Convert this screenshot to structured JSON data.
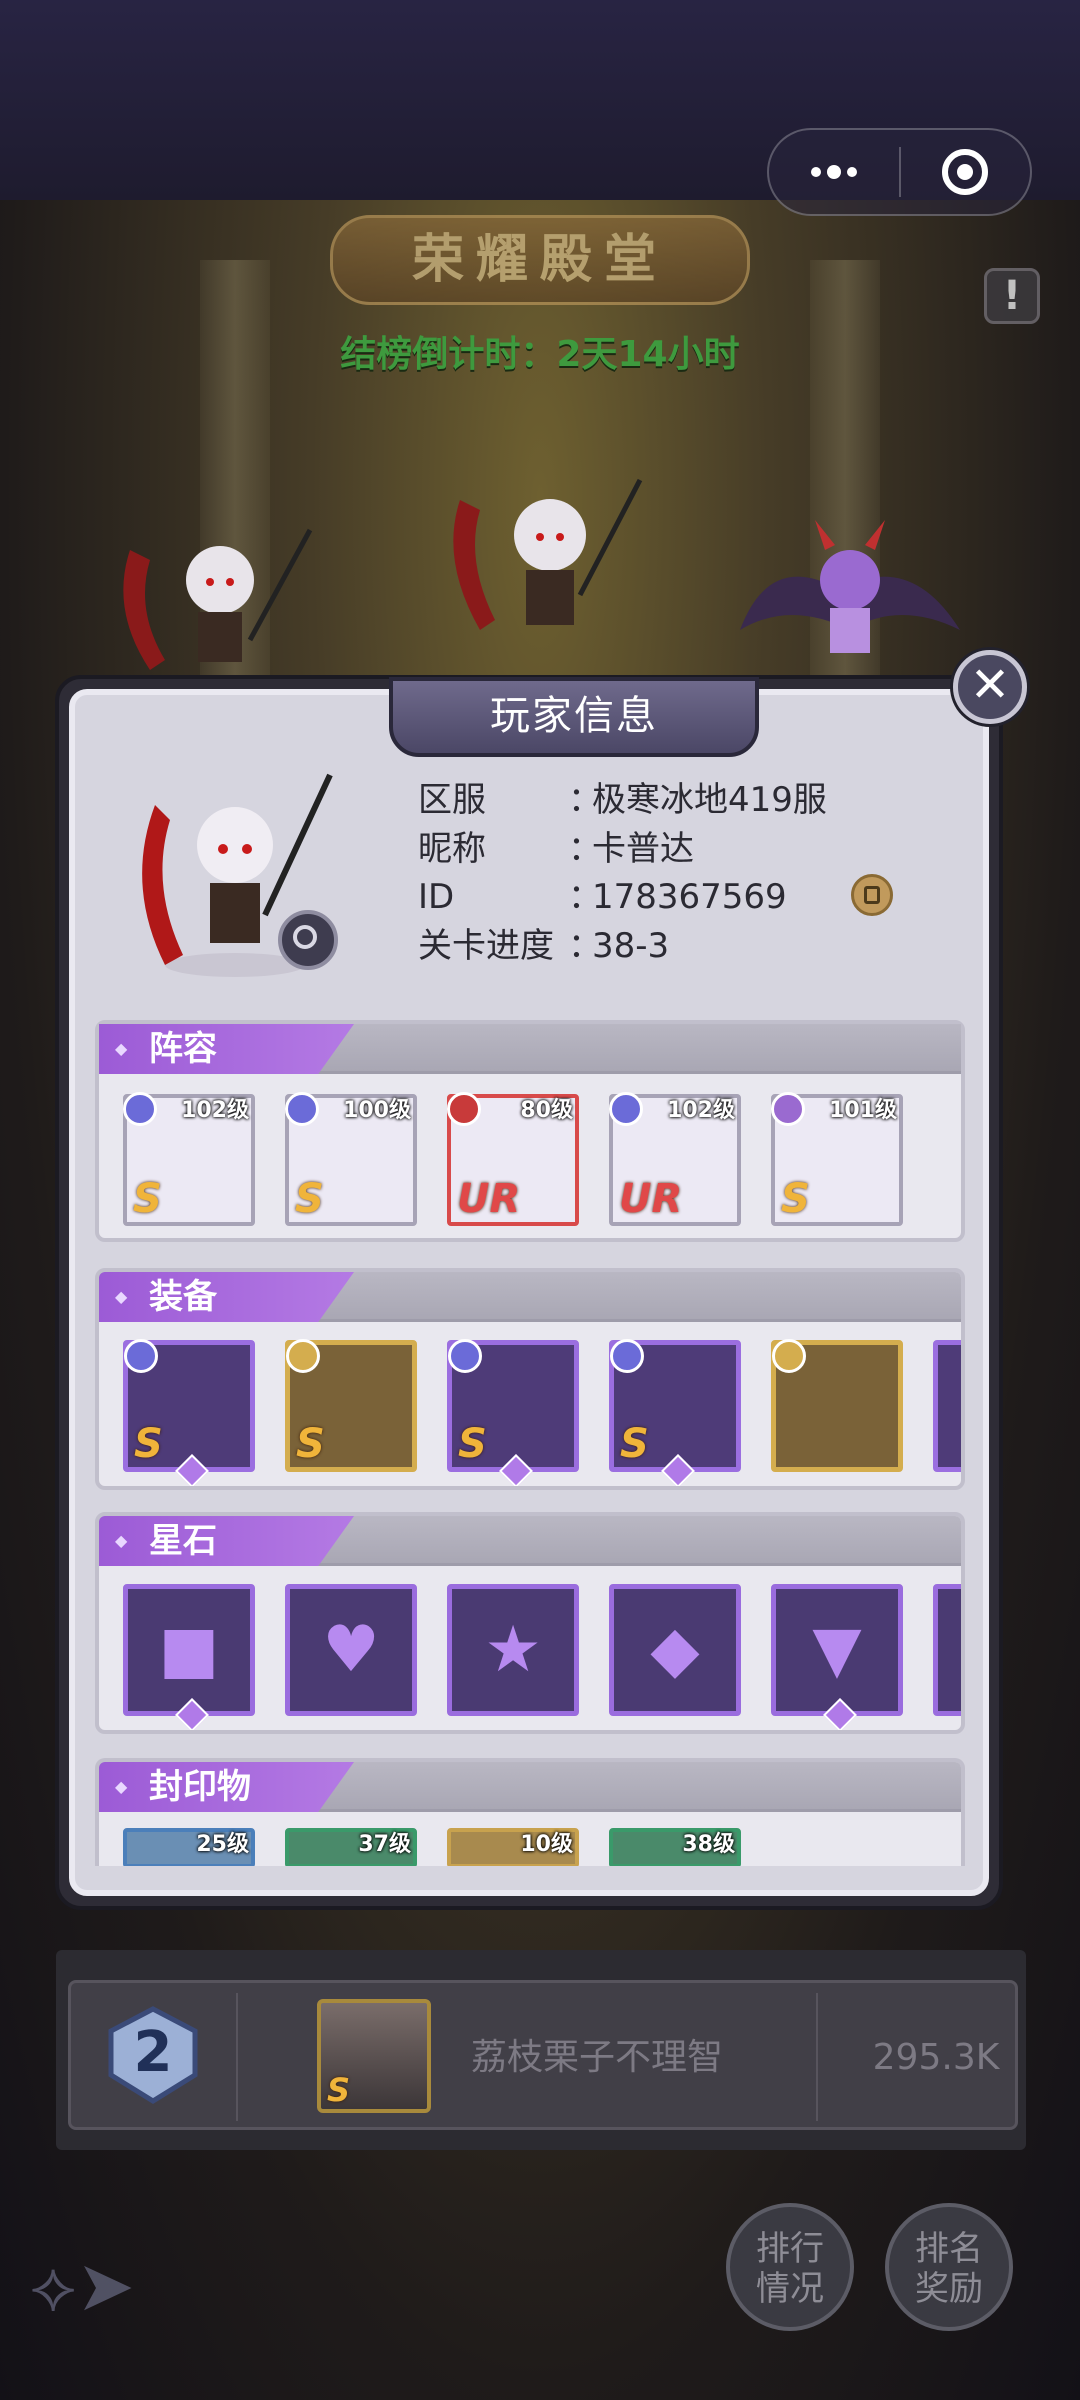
{
  "top_bar": {
    "more_icon": "more-dots-icon",
    "close_icon": "target-icon"
  },
  "hall": {
    "title": "荣耀殿堂",
    "countdown": "结榜倒计时：2天14小时",
    "info_btn": "!"
  },
  "dialog": {
    "title": "玩家信息",
    "close": "✕",
    "server_label": "区服",
    "server_value": "极寒冰地419服",
    "nick_label": "昵称",
    "nick_value": "卡普达",
    "id_label": "ID",
    "id_value": "178367569",
    "stage_label": "关卡进度",
    "stage_value": "38-3",
    "colon": "：",
    "sections": {
      "lineup": "阵容",
      "equipment": "装备",
      "stars": "星石",
      "seals": "封印物"
    },
    "lineup": [
      {
        "level": "102级",
        "grade": "S"
      },
      {
        "level": "100级",
        "grade": "S"
      },
      {
        "level": "80级",
        "grade": "UR"
      },
      {
        "level": "102级",
        "grade": "UR"
      },
      {
        "level": "101级",
        "grade": "S"
      }
    ],
    "equipment": [
      {
        "grade": "S"
      },
      {
        "grade": "S"
      },
      {
        "grade": "S"
      },
      {
        "grade": "S"
      },
      {
        "grade": ""
      }
    ],
    "seal_levels": [
      "25级",
      "37级",
      "10级",
      "38级"
    ]
  },
  "rank_row": {
    "rank": "2",
    "name": "荔枝栗子不理智",
    "score": "295.3K",
    "avatar_grade": "S"
  },
  "bottom": {
    "ranking_btn": "排行\n情况",
    "reward_btn": "排名\n奖励"
  }
}
